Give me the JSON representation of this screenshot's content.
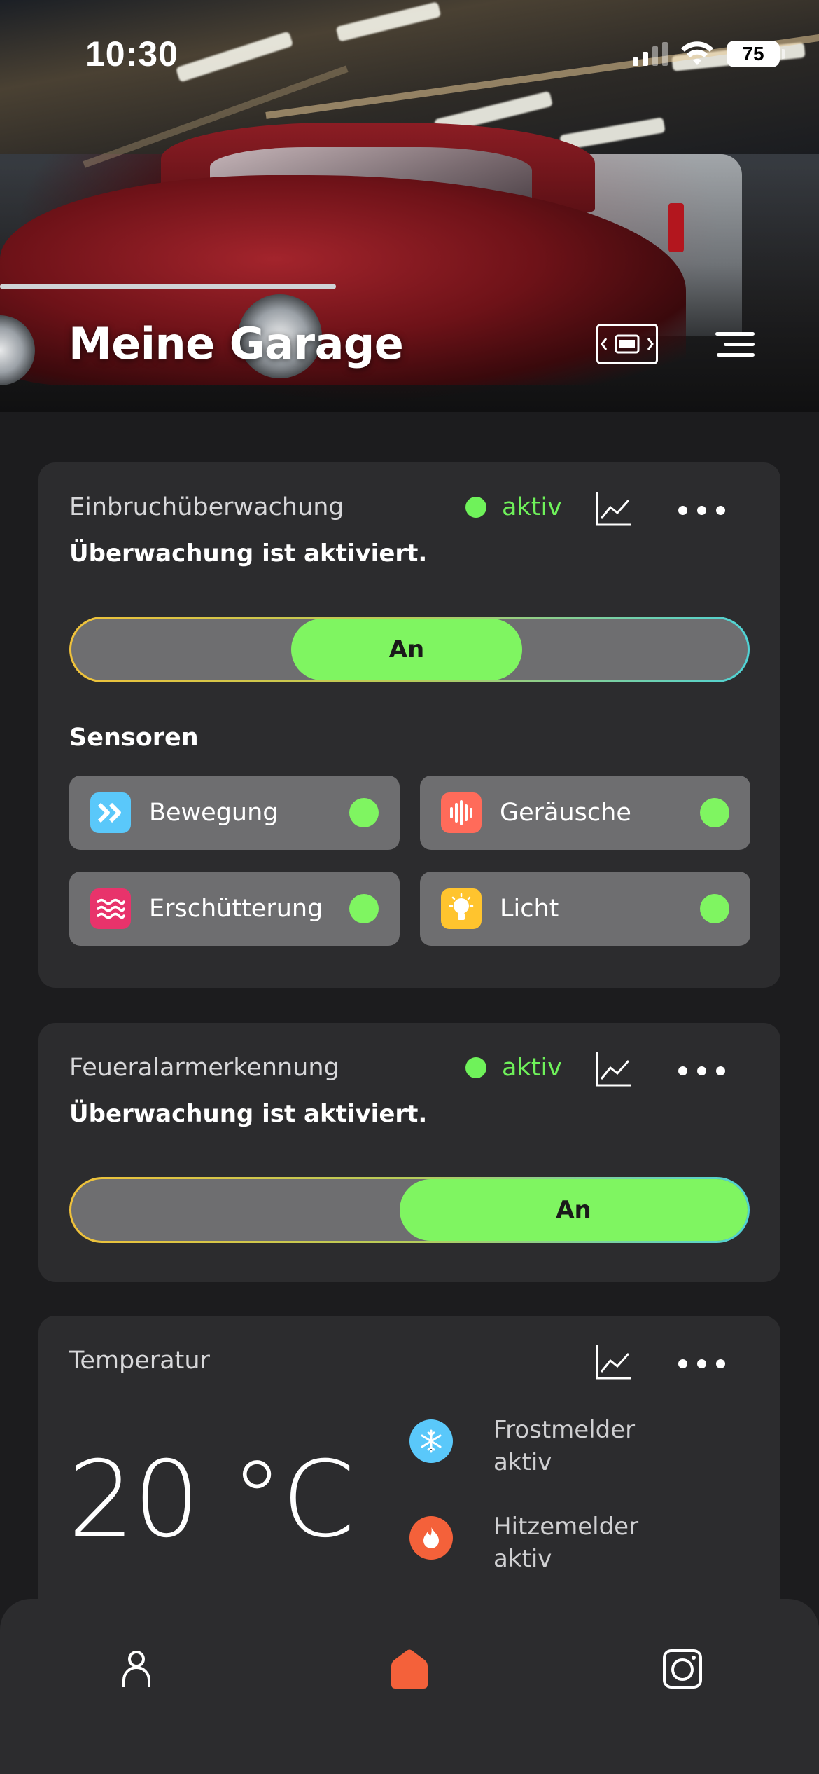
{
  "status_bar": {
    "time": "10:30",
    "battery": "75"
  },
  "header": {
    "title": "Meine Garage"
  },
  "colors": {
    "active_green": "#6ff25a",
    "toggle_green": "#7ff561",
    "card_bg": "#2c2c2e",
    "accent_orange": "#f4613a"
  },
  "intrusion": {
    "title": "Einbruchüberwachung",
    "status": "aktiv",
    "subtitle": "Überwachung ist aktiviert.",
    "toggle_label": "An",
    "sensors_title": "Sensoren",
    "sensors": [
      {
        "label": "Bewegung",
        "icon": "forward-arrows-icon",
        "color": "#5ac8fa"
      },
      {
        "label": "Geräusche",
        "icon": "sound-wave-icon",
        "color": "#ff6b5a"
      },
      {
        "label": "Erschütterung",
        "icon": "vibration-waves-icon",
        "color": "#e8336b"
      },
      {
        "label": "Licht",
        "icon": "light-bulb-icon",
        "color": "#ffc42e"
      }
    ]
  },
  "fire": {
    "title": "Feueralarmerkennung",
    "status": "aktiv",
    "subtitle": "Überwachung ist aktiviert.",
    "toggle_label": "An"
  },
  "temperature": {
    "title": "Temperatur",
    "value": "20 °C",
    "frost": {
      "name": "Frostmelder",
      "state": "aktiv",
      "icon": "snowflake-icon",
      "color": "#5ac8fa"
    },
    "heat": {
      "name": "Hitzemelder",
      "state": "aktiv",
      "icon": "flame-icon",
      "color": "#f4613a"
    }
  },
  "tabbar": {
    "items": [
      "person-icon",
      "home-icon",
      "camera-icon"
    ],
    "active": "home-icon"
  }
}
